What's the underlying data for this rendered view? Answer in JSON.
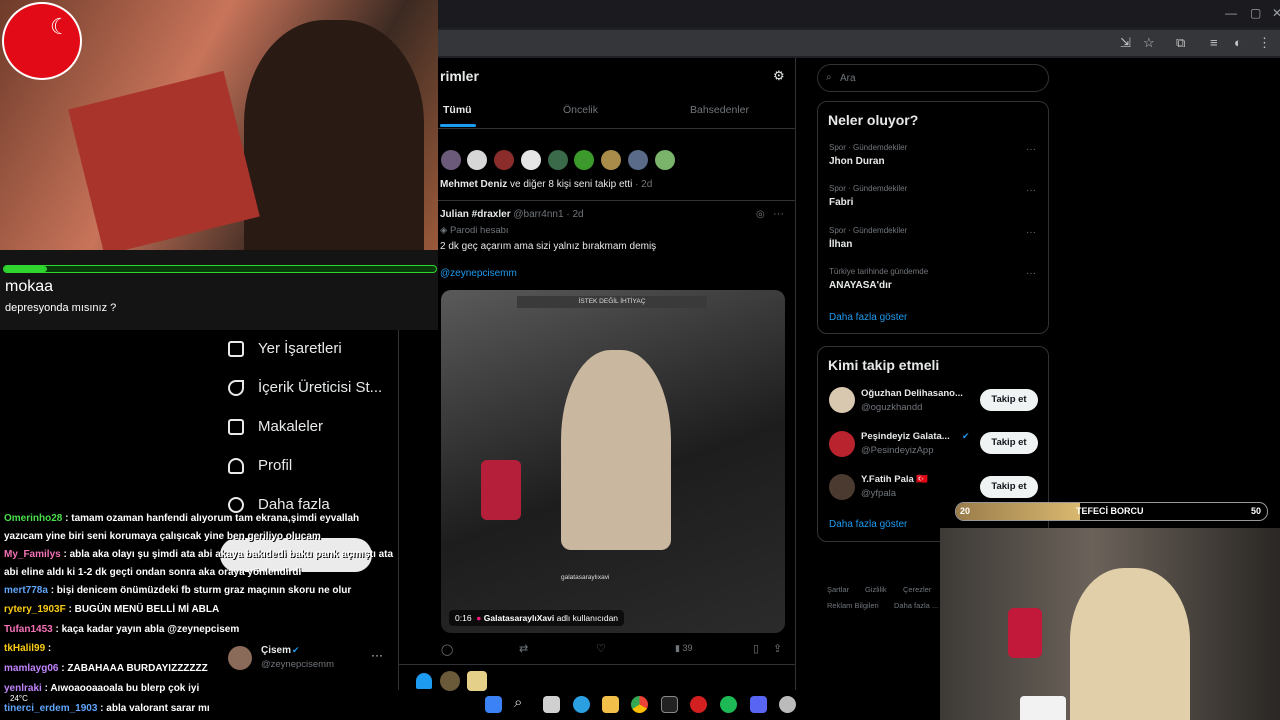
{
  "stream": {
    "song_title": "mokaa",
    "song_subtitle": "depresyonda mısınız ?",
    "progress": 0.1,
    "debt_bar": {
      "left_value": "20",
      "label": "TEFECİ BORCU",
      "right_value": "50",
      "fill": 0.4
    }
  },
  "chat": [
    {
      "user": "Omerinho28",
      "msg": ": tamam ozaman hanfendi alıyorum tam ekrana,şimdi eyvallah",
      "color": "green"
    },
    {
      "user": "",
      "msg": "yazıcam yine biri seni korumaya çalışıcak yine ben geriliyo olucam",
      "color": "white"
    },
    {
      "user": "My_Familys",
      "msg": ": abla aka olayı şu şimdi ata abi akaya bakıdedi baktı pank açmıştı ata",
      "color": "pink"
    },
    {
      "user": "",
      "msg": "abi eline aldı ki 1-2 dk geçti ondan sonra aka oraya yönlendirdi",
      "color": "white"
    },
    {
      "user": "mert778a",
      "msg": ": bişi denicem önümüzdeki fb sturm graz maçının skoru ne olur",
      "color": "blue"
    },
    {
      "user": "rytery_1903F",
      "msg": ": BUGÜN MENÜ BELLİ Mİ ABLA",
      "color": "yellow"
    },
    {
      "user": "Tufan1453",
      "msg": ": kaça kadar yayın abla @zeynepcisem",
      "color": "pink"
    },
    {
      "user": "tkHalil99",
      "msg": ":",
      "color": "yellow"
    },
    {
      "user": "mamlayg06",
      "msg": ": ZABAHAAA BURDAYIZZZZZZ",
      "color": "purple"
    },
    {
      "user": "yenlraki",
      "msg": ": Aıwoaooaaoala bu blerp çok iyi",
      "color": "purple"
    },
    {
      "user": "tinerci_erdem_1903",
      "msg": ": abla valorant sarar mı",
      "color": "blue"
    }
  ],
  "sidebar": {
    "items": [
      {
        "label": "Yer İşaretleri",
        "icon": "bookmark-icon"
      },
      {
        "label": "İçerik Üreticisi St...",
        "icon": "rocket-icon"
      },
      {
        "label": "Makaleler",
        "icon": "article-icon"
      },
      {
        "label": "Profil",
        "icon": "person-icon"
      },
      {
        "label": "Daha fazla",
        "icon": "more-circle-icon"
      }
    ],
    "account": {
      "name": "Çisem",
      "handle": "@zeynepcisemm"
    }
  },
  "notifications": {
    "title": "rimler",
    "tabs": [
      "Tümü",
      "Öncelik",
      "Bahsedenler"
    ],
    "follow_notice": {
      "text": "Mehmet Deniz",
      "rest": " ve diğer 8 kişi seni takip etti",
      "time": "· 2d"
    },
    "post": {
      "author": "Julian #draxler",
      "handle": "@barr4nn1",
      "time": "· 2d",
      "parody_label": "Parodi hesabı",
      "text": "2 dk geç açarım ama sizi yalnız bırakmam demiş",
      "mention": "@zeynepcisemm",
      "video_duration": "0:16",
      "video_source": "GalatasaraylıXavi",
      "video_source_suffix": "adlı kullanıcıdan",
      "video_overlay_top": "İSTEK DEĞİL İHTİYAÇ",
      "video_overlay_bottom": "galatasaraylıxavi",
      "views": "39"
    }
  },
  "right": {
    "search_placeholder": "Ara",
    "trends_title": "Neler oluyor?",
    "trends": [
      {
        "category": "Spor · Gündemdekiler",
        "name": "Jhon Duran"
      },
      {
        "category": "Spor · Gündemdekiler",
        "name": "Fabri"
      },
      {
        "category": "Spor · Gündemdekiler",
        "name": "İlhan"
      },
      {
        "category": "Türkiye tarihinde gündemde",
        "name": "ANAYASA'dır"
      }
    ],
    "show_more": "Daha fazla göster",
    "who_title": "Kimi takip etmeli",
    "who": [
      {
        "name": "Oğuzhan Delihasano...",
        "handle": "@oguzkhandd",
        "button": "Takip et"
      },
      {
        "name": "Peşindeyiz Galata...",
        "handle": "@PesindeyizApp",
        "button": "Takip et"
      },
      {
        "name": "Y.Fatih Pala 🇹🇷",
        "handle": "@yfpala",
        "button": "Takip et"
      }
    ],
    "who_more": "Daha fazla göster",
    "footer": [
      "Şartlar",
      "Gizlilik",
      "Çerezler",
      "Reklam Bilgileri",
      "Daha fazla ..."
    ]
  },
  "system": {
    "weather": "24°C"
  }
}
